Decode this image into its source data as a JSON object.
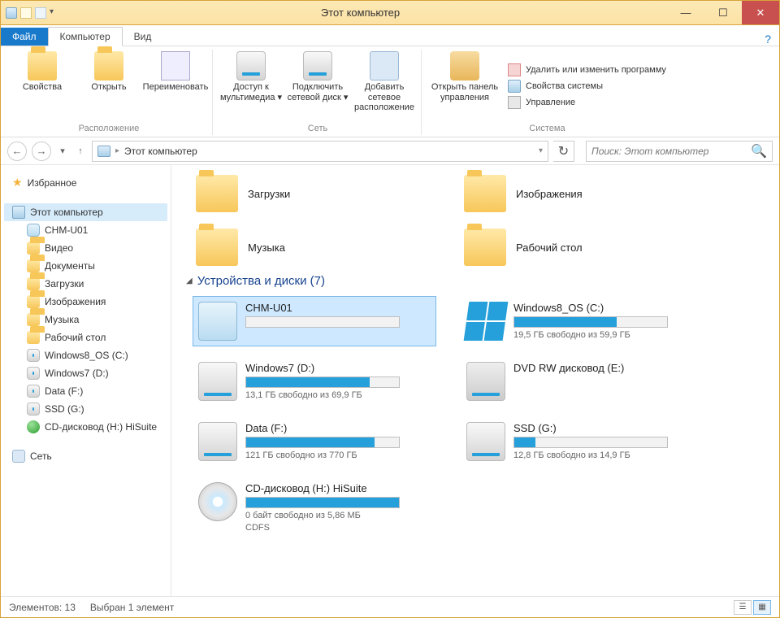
{
  "window": {
    "title": "Этот компьютер"
  },
  "tabs": {
    "file": "Файл",
    "computer": "Компьютер",
    "view": "Вид"
  },
  "ribbon": {
    "g1": {
      "cap": "Расположение",
      "props": "Свойства",
      "open": "Открыть",
      "rename": "Переименовать"
    },
    "g2": {
      "cap": "Сеть",
      "media": "Доступ к мультимедиа ▾",
      "map": "Подключить сетевой диск ▾",
      "addnet": "Добавить сетевое расположение"
    },
    "g3": {
      "cap": "Система",
      "cp": "Открыть панель управления",
      "uninstall": "Удалить или изменить программу",
      "sysprop": "Свойства системы",
      "manage": "Управление"
    }
  },
  "nav": {
    "crumb_root": "Этот компьютер",
    "search_placeholder": "Поиск: Этот компьютер"
  },
  "tree": {
    "fav": "Избранное",
    "pc": "Этот компьютер",
    "items": [
      "CHM-U01",
      "Видео",
      "Документы",
      "Загрузки",
      "Изображения",
      "Музыка",
      "Рабочий стол",
      "Windows8_OS (C:)",
      "Windows7 (D:)",
      "Data (F:)",
      "SSD (G:)",
      "CD-дисковод (H:) HiSuite"
    ],
    "net": "Сеть"
  },
  "folders": {
    "downloads": "Загрузки",
    "pictures": "Изображения",
    "music": "Музыка",
    "desktop": "Рабочий стол"
  },
  "devices": {
    "heading": "Устройства и диски (7)",
    "list": [
      {
        "name": "CHM-U01",
        "sub": "",
        "fill": 0,
        "icon": "phone",
        "selected": true
      },
      {
        "name": "Windows8_OS (C:)",
        "sub": "19,5 ГБ свободно из 59,9 ГБ",
        "fill": 67,
        "icon": "winlogo"
      },
      {
        "name": "Windows7 (D:)",
        "sub": "13,1 ГБ свободно из 69,9 ГБ",
        "fill": 81,
        "icon": "drive"
      },
      {
        "name": "DVD RW дисковод (E:)",
        "sub": "",
        "fill": -1,
        "icon": "dvd"
      },
      {
        "name": "Data (F:)",
        "sub": "121 ГБ свободно из 770 ГБ",
        "fill": 84,
        "icon": "drive"
      },
      {
        "name": "SSD (G:)",
        "sub": "12,8 ГБ свободно из 14,9 ГБ",
        "fill": 14,
        "icon": "drive"
      },
      {
        "name": "CD-дисковод (H:) HiSuite",
        "sub": "0 байт свободно из 5,86 МБ",
        "sub2": "CDFS",
        "fill": 100,
        "icon": "cd"
      }
    ]
  },
  "status": {
    "count": "Элементов: 13",
    "sel": "Выбран 1 элемент"
  }
}
